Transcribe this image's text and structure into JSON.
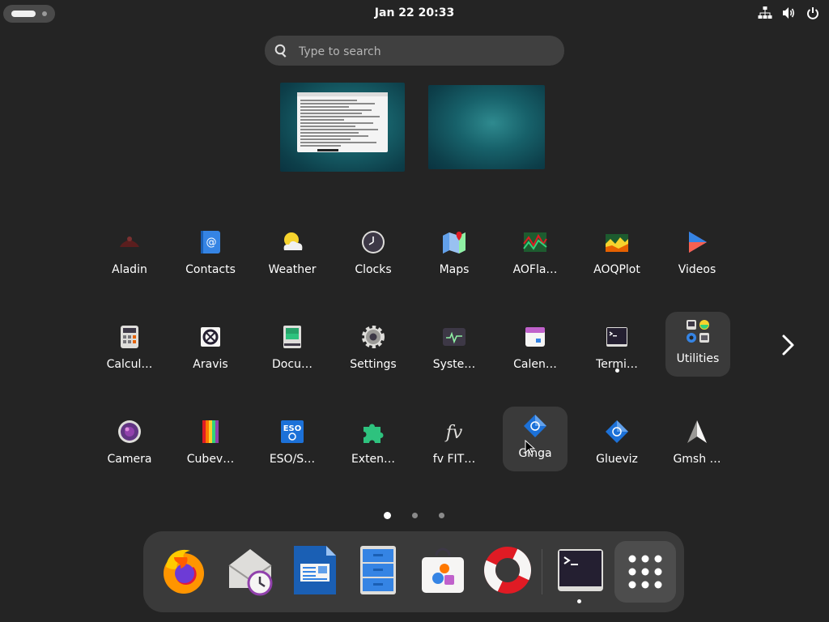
{
  "topbar": {
    "clock": "Jan 22  20:33"
  },
  "search": {
    "placeholder": "Type to search"
  },
  "apps": {
    "row1": [
      "Aladin",
      "Contacts",
      "Weather",
      "Clocks",
      "Maps",
      "AOFla…",
      "AOQPlot",
      "Videos"
    ],
    "row2": [
      "Calcul…",
      "Aravis",
      "Docu…",
      "Settings",
      "Syste…",
      "Calen…",
      "Termi…",
      "Utilities"
    ],
    "row3": [
      "Camera",
      "Cubev…",
      "ESO/S…",
      "Exten…",
      "fv FIT…",
      "Ginga",
      "Glueviz",
      "Gmsh …"
    ]
  },
  "pages": {
    "count": 3,
    "current": 1
  },
  "icons": {
    "topbar": [
      "network-icon",
      "volume-icon",
      "power-icon"
    ],
    "dock": [
      "firefox-icon",
      "evolution-icon",
      "writer-icon",
      "files-icon",
      "software-icon",
      "help-icon",
      "terminal-icon",
      "app-grid-icon"
    ]
  },
  "colors": {
    "background": "#242424",
    "panel": "#3a3a3a",
    "accent": "#3584e4"
  }
}
